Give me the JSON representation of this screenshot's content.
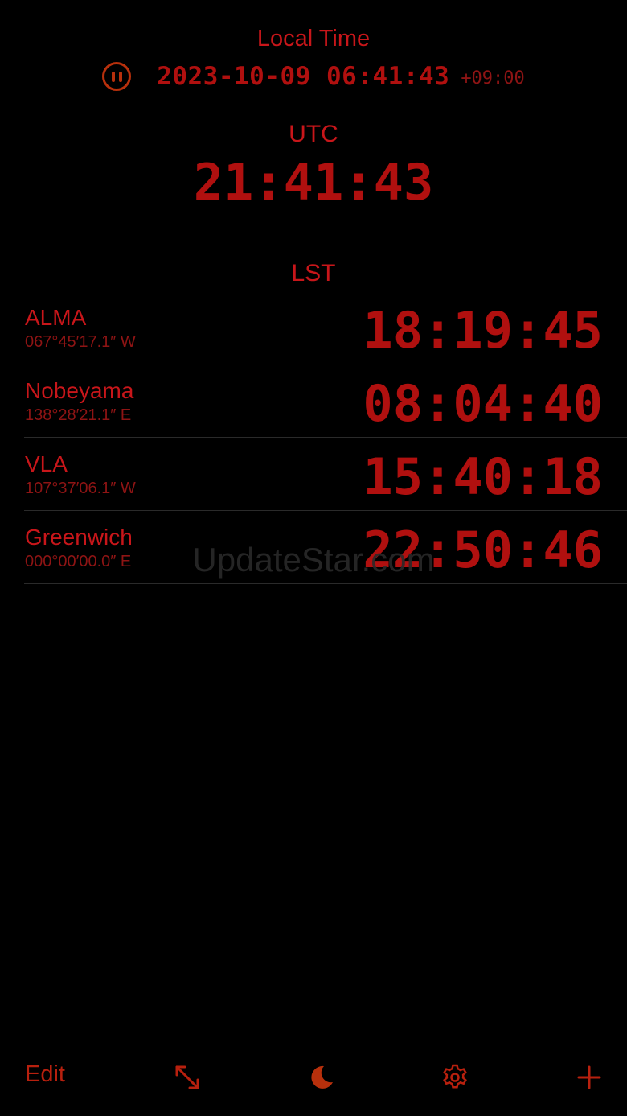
{
  "local_time": {
    "title": "Local Time",
    "datetime": "2023-10-09 06:41:43",
    "offset": "+09:00",
    "pause_icon": "pause-circle-icon"
  },
  "utc": {
    "title": "UTC",
    "time": "21:41:43"
  },
  "lst": {
    "title": "LST",
    "sites": [
      {
        "name": "ALMA",
        "longitude": "067°45′17.1″ W",
        "lst": "18:19:45"
      },
      {
        "name": "Nobeyama",
        "longitude": "138°28′21.1″ E",
        "lst": "08:04:40"
      },
      {
        "name": "VLA",
        "longitude": "107°37′06.1″ W",
        "lst": "15:40:18"
      },
      {
        "name": "Greenwich",
        "longitude": "000°00′00.0″ E",
        "lst": "22:50:46"
      }
    ]
  },
  "watermark": "UpdateStar.com",
  "toolbar": {
    "edit_label": "Edit",
    "icons": [
      "expand-icon",
      "moon-icon",
      "gear-icon",
      "plus-icon"
    ]
  },
  "colors": {
    "background": "#000000",
    "primary_red": "#b0100f",
    "accent_orange_red": "#b8300c"
  }
}
